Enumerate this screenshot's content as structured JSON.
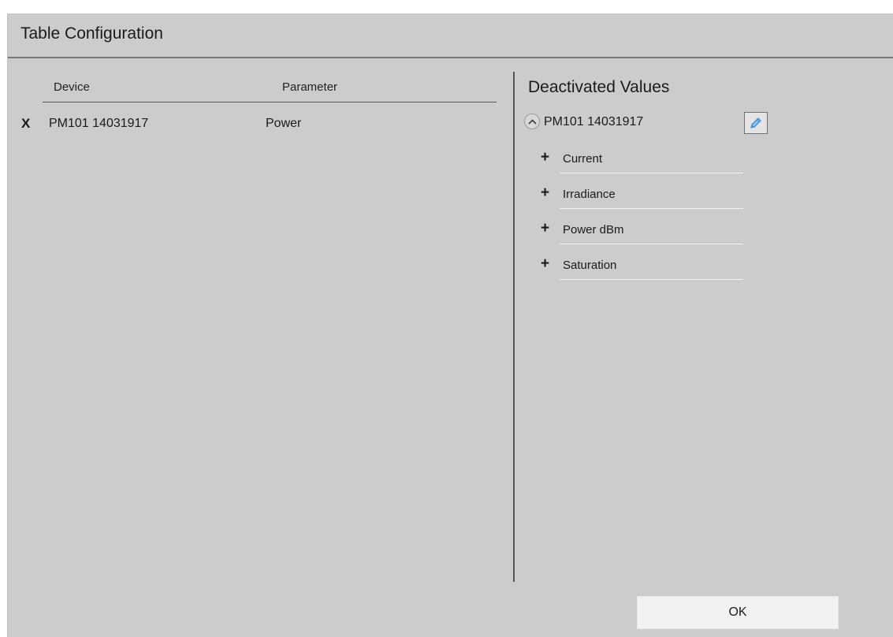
{
  "dialog": {
    "title": "Table Configuration"
  },
  "table": {
    "columns": {
      "device": "Device",
      "parameter": "Parameter"
    },
    "rows": [
      {
        "remove": "X",
        "device": "PM101 14031917",
        "parameter": "Power"
      }
    ]
  },
  "deactivated": {
    "title": "Deactivated Values",
    "group": {
      "name": "PM101 14031917",
      "collapse_icon": "chevron-up-icon",
      "edit_icon": "pencil-icon",
      "items": [
        {
          "icon": "+",
          "label": "Current"
        },
        {
          "icon": "+",
          "label": "Irradiance"
        },
        {
          "icon": "+",
          "label": "Power dBm"
        },
        {
          "icon": "+",
          "label": "Saturation"
        }
      ]
    }
  },
  "footer": {
    "ok_label": "OK"
  },
  "colors": {
    "dialog_bg": "#cccccc",
    "rule": "#555555",
    "accent_icon": "#3a8ee6"
  }
}
